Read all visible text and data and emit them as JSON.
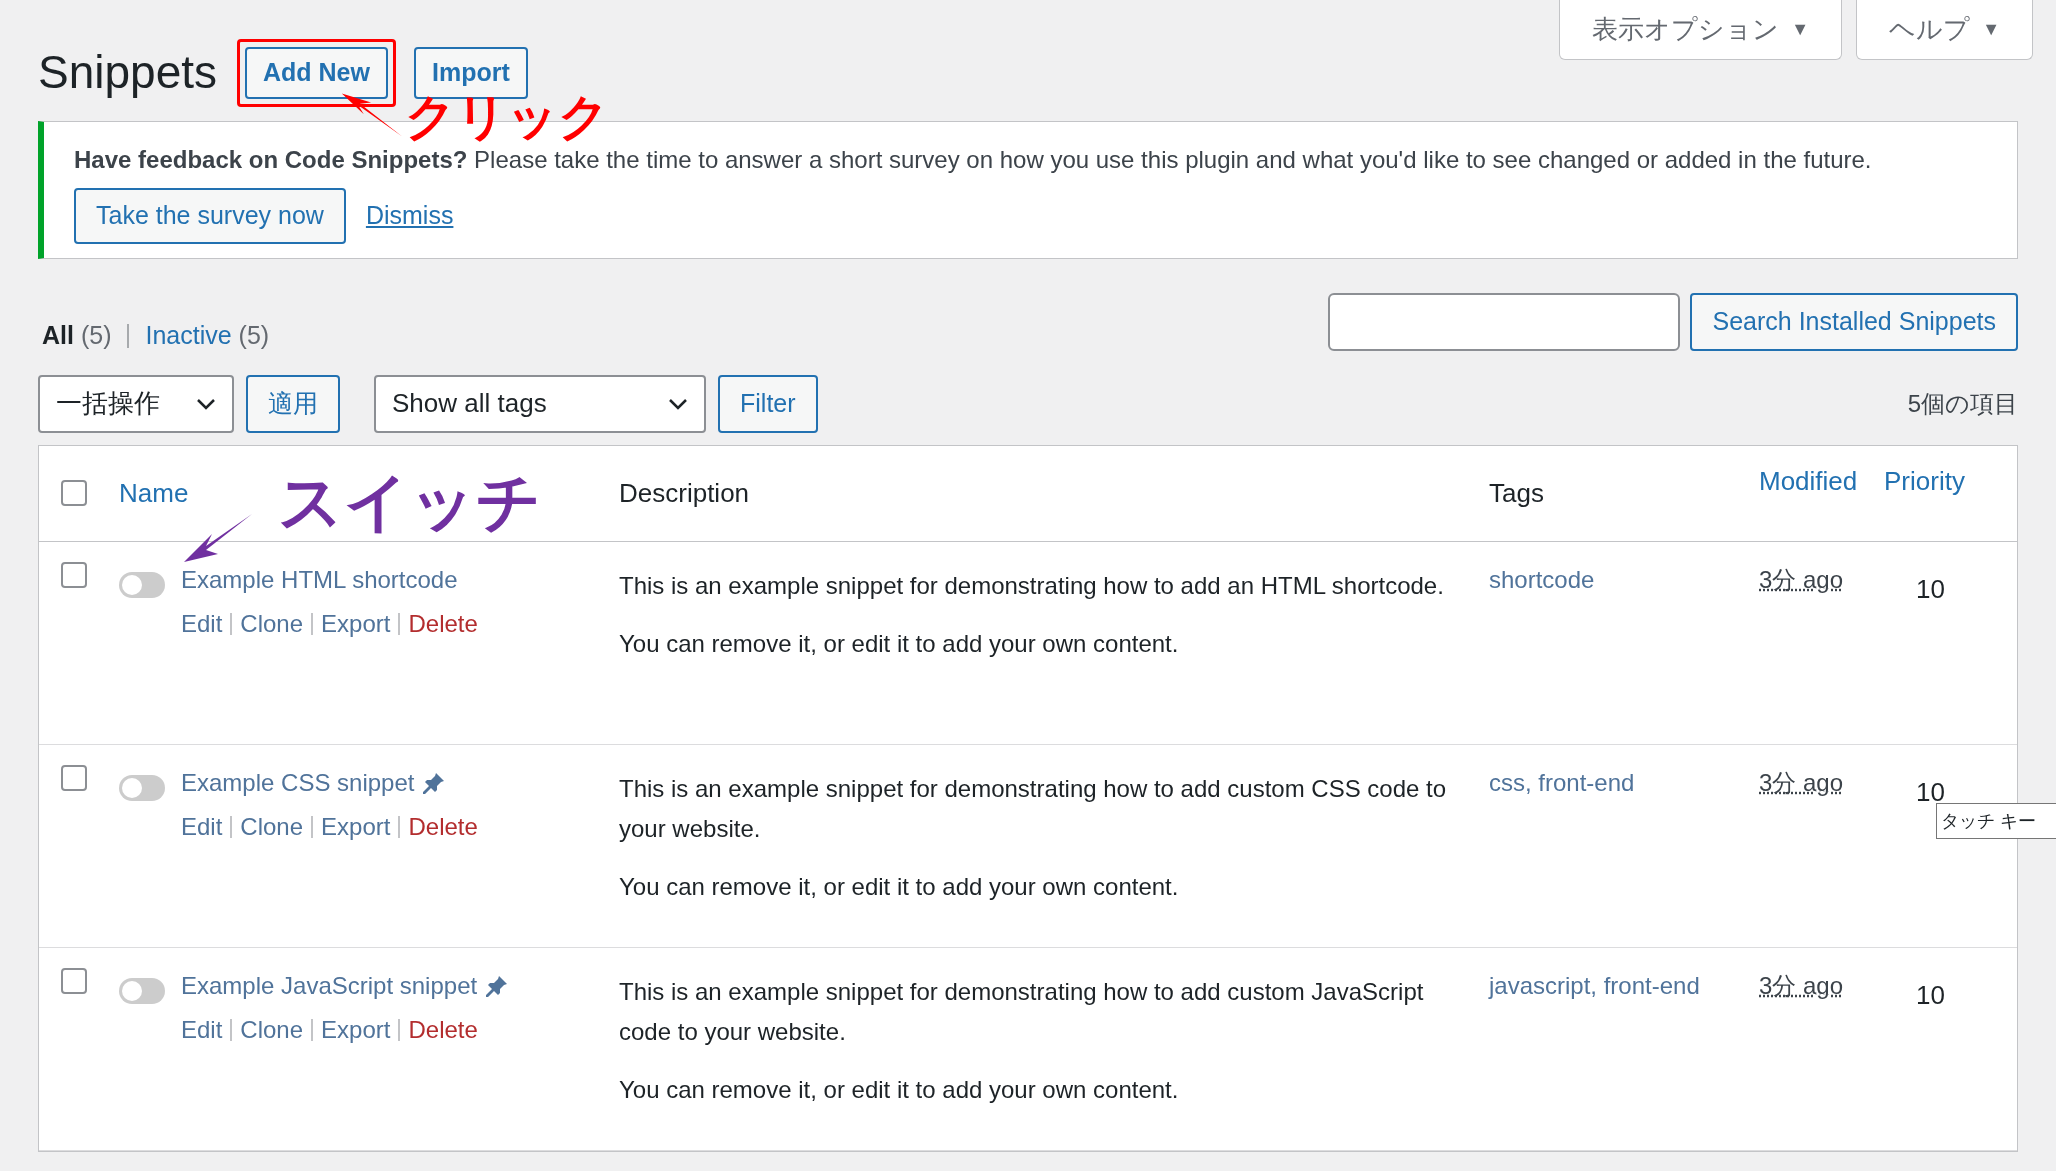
{
  "screen_tabs": [
    {
      "label": "表示オプション",
      "symbol": "▼"
    },
    {
      "label": "ヘルプ",
      "symbol": "▼"
    }
  ],
  "page": {
    "title": "Snippets",
    "buttons": [
      {
        "label": "Add New",
        "highlighted": true
      },
      {
        "label": "Import",
        "highlighted": false
      }
    ]
  },
  "notice": {
    "lead": "Have feedback on Code Snippets?",
    "text": "Please take the time to answer a short survey on how you use this plugin and what you'd like to see changed or added in the future.",
    "button": "Take the survey now",
    "link": "Dismiss"
  },
  "views": [
    {
      "label": "All",
      "count": "(5)",
      "selected": true
    },
    {
      "label": "Inactive",
      "count": "(5)",
      "selected": false
    }
  ],
  "search": {
    "button": "Search Installed Snippets"
  },
  "bulk": {
    "select": "一括操作",
    "apply": "適用",
    "tags_select": "Show all tags",
    "filter": "Filter",
    "count": "5個の項目"
  },
  "table": {
    "select_all_checked": false,
    "columns": [
      {
        "label": "Name",
        "sortable": true
      },
      {
        "label": "Description",
        "sortable": false
      },
      {
        "label": "Tags",
        "sortable": false
      },
      {
        "label": "Modified",
        "sortable": true
      },
      {
        "label": "Priority",
        "sortable": true
      }
    ],
    "rows": [
      {
        "checked": false,
        "active": false,
        "name": "Example HTML shortcode",
        "pinned": false,
        "actions": [
          {
            "label": "Edit",
            "kind": "normal"
          },
          {
            "label": "Clone",
            "kind": "normal"
          },
          {
            "label": "Export",
            "kind": "normal"
          },
          {
            "label": "Delete",
            "kind": "danger"
          }
        ],
        "description": [
          "This is an example snippet for demonstrating how to add an HTML shortcode.",
          "You can remove it, or edit it to add your own content."
        ],
        "tags": "shortcode",
        "modified": "3分 ago",
        "priority": "10"
      },
      {
        "checked": false,
        "active": false,
        "name": "Example CSS snippet",
        "pinned": true,
        "actions": [
          {
            "label": "Edit",
            "kind": "normal"
          },
          {
            "label": "Clone",
            "kind": "normal"
          },
          {
            "label": "Export",
            "kind": "normal"
          },
          {
            "label": "Delete",
            "kind": "danger"
          }
        ],
        "description": [
          "This is an example snippet for demonstrating how to add custom CSS code to your website.",
          "You can remove it, or edit it to add your own content."
        ],
        "tags": "css, front-end",
        "modified": "3分 ago",
        "priority": "10"
      },
      {
        "checked": false,
        "active": false,
        "name": "Example JavaScript snippet",
        "pinned": true,
        "actions": [
          {
            "label": "Edit",
            "kind": "normal"
          },
          {
            "label": "Clone",
            "kind": "normal"
          },
          {
            "label": "Export",
            "kind": "normal"
          },
          {
            "label": "Delete",
            "kind": "danger"
          }
        ],
        "description": [
          "This is an example snippet for demonstrating how to add custom JavaScript code to your website.",
          "You can remove it, or edit it to add your own content."
        ],
        "tags": "javascript, front-end",
        "modified": "3分 ago",
        "priority": "10"
      }
    ]
  },
  "tooltip": "タッチ キー",
  "annotations": [
    {
      "text": "クリック",
      "color": "#ff0000"
    },
    {
      "text": "スイッチ",
      "color": "#7030a0"
    }
  ]
}
